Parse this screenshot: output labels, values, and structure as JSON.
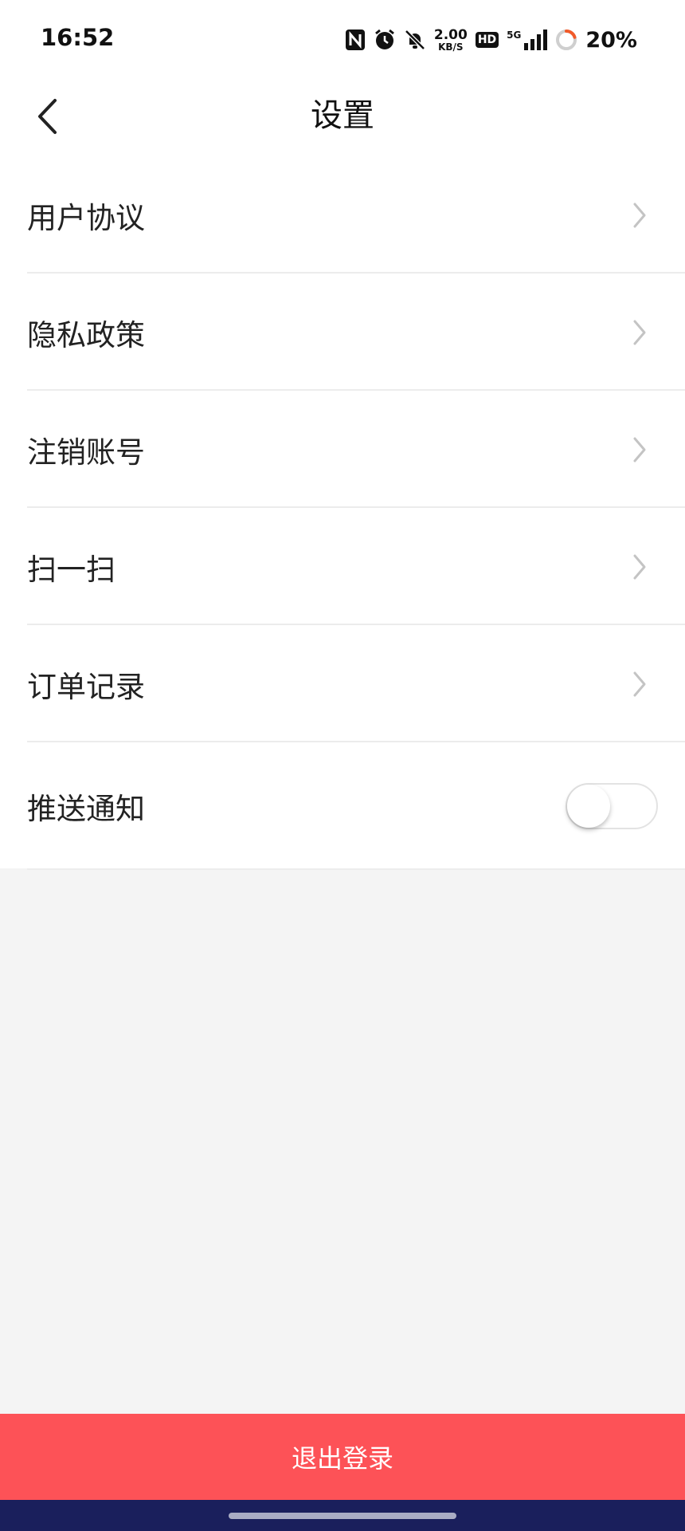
{
  "status_bar": {
    "time": "16:52",
    "net_speed_value": "2.00",
    "net_speed_unit": "KB/S",
    "hd_label": "HD",
    "network_label": "5G",
    "battery": "20%",
    "battery_level": 0.2,
    "icons": [
      "nfc-icon",
      "alarm-icon",
      "bell-muted-icon",
      "hd-icon",
      "signal-icon",
      "battery-ring-icon"
    ]
  },
  "header": {
    "title": "设置",
    "back_icon": "chevron-left-icon"
  },
  "settings": {
    "items": [
      {
        "label": "用户协议"
      },
      {
        "label": "隐私政策"
      },
      {
        "label": "注销账号"
      },
      {
        "label": "扫一扫"
      },
      {
        "label": "订单记录"
      }
    ],
    "push": {
      "label": "推送通知",
      "enabled": false
    }
  },
  "footer": {
    "logout_label": "退出登录"
  },
  "colors": {
    "accent": "#fd5257",
    "nav_bar": "#1a1f5c",
    "background": "#f4f4f4"
  }
}
